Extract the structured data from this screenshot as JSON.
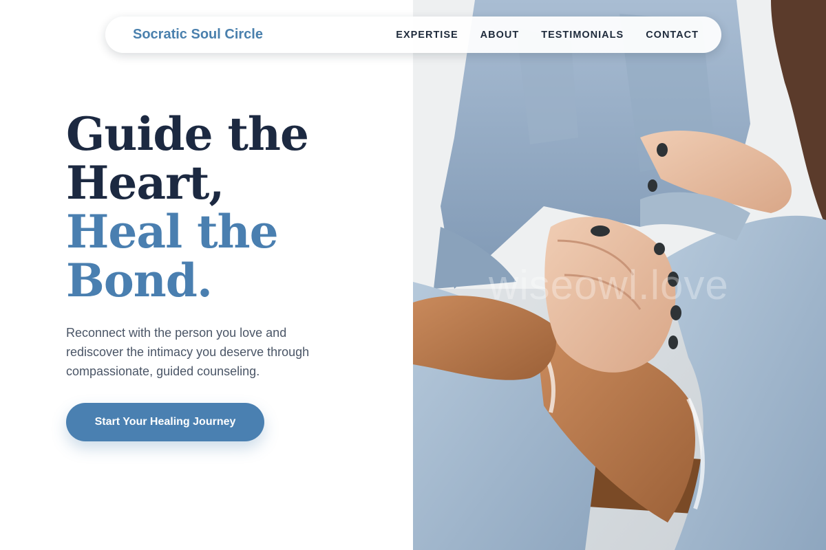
{
  "nav": {
    "brand": "Socratic Soul Circle",
    "links": [
      "EXPERTISE",
      "ABOUT",
      "TESTIMONIALS",
      "CONTACT"
    ]
  },
  "hero": {
    "title_line1": "Guide the",
    "title_line2": "Heart,",
    "title_line3": "Heal the",
    "title_line4": "Bond.",
    "subtitle": "Reconnect with the person you love and rediscover the intimacy you deserve through compassionate, guided counseling.",
    "cta_label": "Start Your Healing Journey"
  },
  "photo": {
    "watermark": "wiseowl.love"
  },
  "colors": {
    "brand": "#4a80ad",
    "heading_dark": "#1c2941",
    "heading_accent": "#4a7fb0",
    "cta_bg": "#4a80b1"
  }
}
